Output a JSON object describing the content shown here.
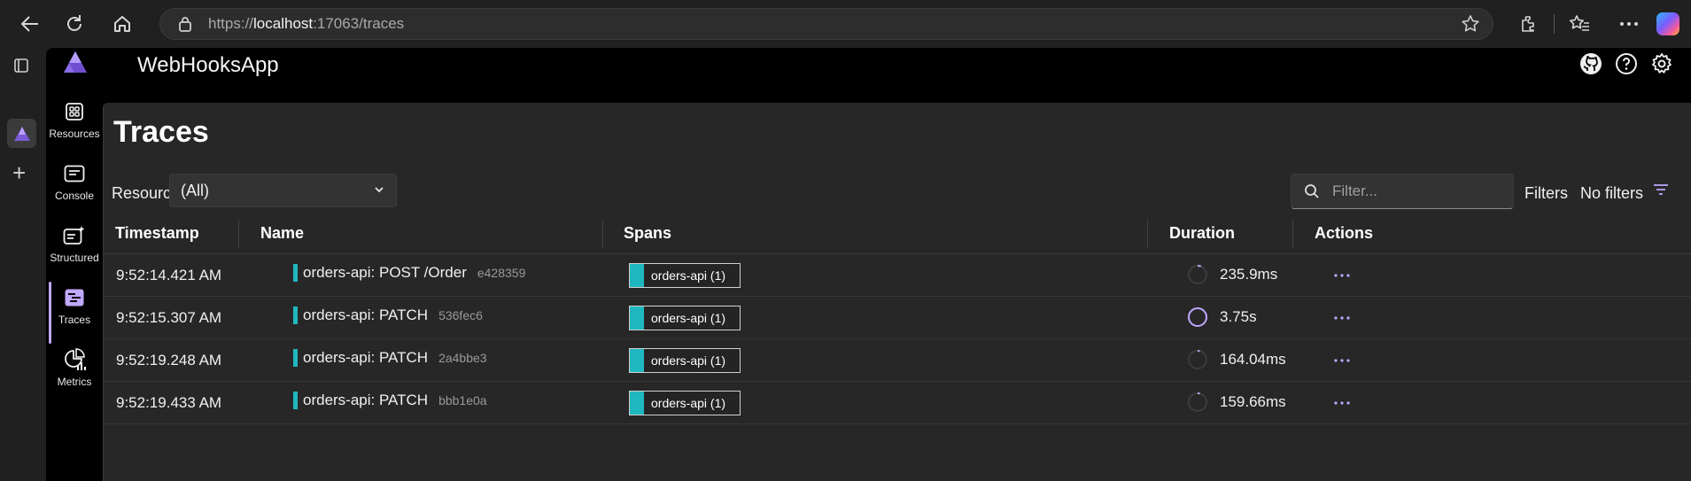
{
  "browser": {
    "url_protocol": "https://",
    "url_host": "localhost",
    "url_rest": ":17063/traces"
  },
  "app": {
    "title": "WebHooksApp"
  },
  "nav": {
    "items": [
      {
        "label": "Resources",
        "icon": "resources-icon"
      },
      {
        "label": "Console",
        "icon": "console-icon"
      },
      {
        "label": "Structured",
        "icon": "structured-icon"
      },
      {
        "label": "Traces",
        "icon": "traces-icon",
        "active": true
      },
      {
        "label": "Metrics",
        "icon": "metrics-icon"
      }
    ]
  },
  "page": {
    "title": "Traces",
    "resource_label": "Resource",
    "resource_value": "(All)",
    "filter_placeholder": "Filter...",
    "filters_label": "Filters",
    "filters_value": "No filters"
  },
  "table": {
    "columns": [
      "Timestamp",
      "Name",
      "Spans",
      "Duration",
      "Actions"
    ],
    "rows": [
      {
        "timestamp": "9:52:14.421 AM",
        "name": "orders-api: POST /Order",
        "trace_id": "e428359",
        "span": "orders-api (1)",
        "duration": "235.9ms",
        "duration_fraction": 0.06
      },
      {
        "timestamp": "9:52:15.307 AM",
        "name": "orders-api: PATCH",
        "trace_id": "536fec6",
        "span": "orders-api (1)",
        "duration": "3.75s",
        "duration_fraction": 1.0
      },
      {
        "timestamp": "9:52:19.248 AM",
        "name": "orders-api: PATCH",
        "trace_id": "2a4bbe3",
        "span": "orders-api (1)",
        "duration": "164.04ms",
        "duration_fraction": 0.04
      },
      {
        "timestamp": "9:52:19.433 AM",
        "name": "orders-api: PATCH",
        "trace_id": "bbb1e0a",
        "span": "orders-api (1)",
        "duration": "159.66ms",
        "duration_fraction": 0.04
      }
    ]
  },
  "colors": {
    "accent": "#c0a7ff",
    "span_color": "#1fb8c0"
  }
}
